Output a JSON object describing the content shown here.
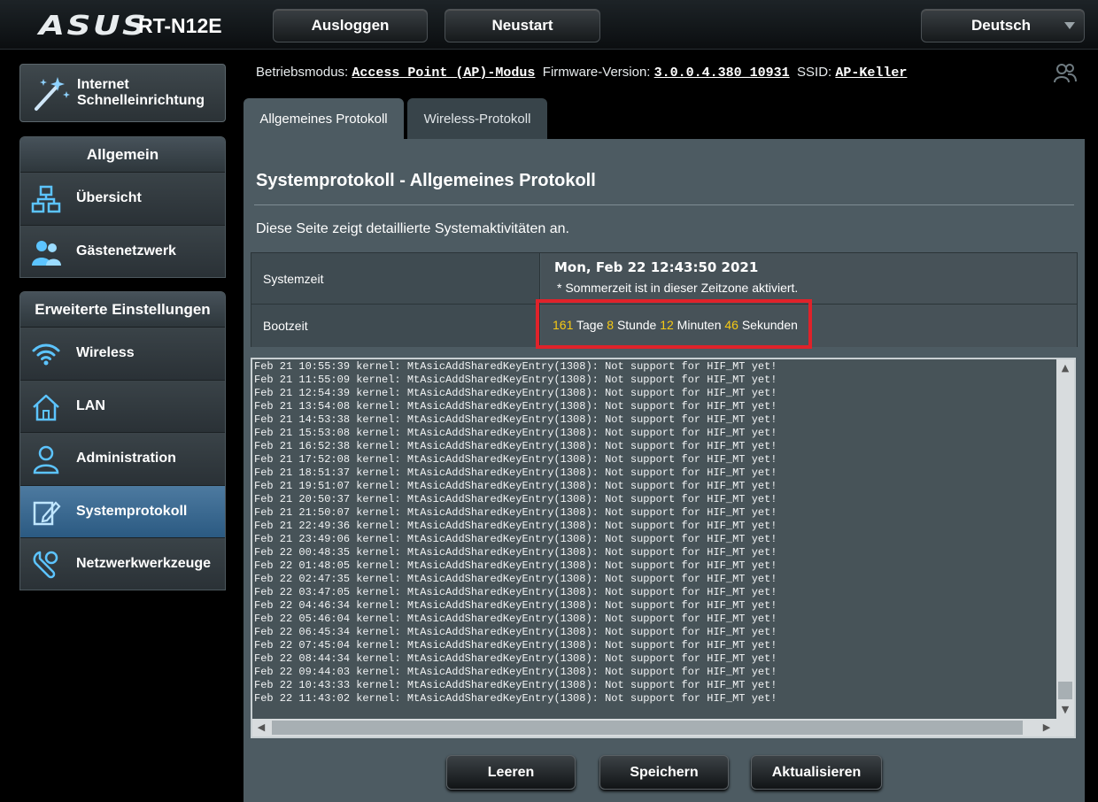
{
  "header": {
    "logo": "ASUS",
    "model": "RT-N12E",
    "logout_label": "Ausloggen",
    "reboot_label": "Neustart",
    "language": "Deutsch"
  },
  "sidebar": {
    "quick_setup": "Internet Schnelleinrichtung",
    "general": {
      "title": "Allgemein",
      "items": [
        {
          "label": "Übersicht",
          "icon": "network-map-icon"
        },
        {
          "label": "Gästenetzwerk",
          "icon": "guest-network-icon"
        }
      ]
    },
    "advanced": {
      "title": "Erweiterte Einstellungen",
      "items": [
        {
          "label": "Wireless",
          "icon": "wifi-icon"
        },
        {
          "label": "LAN",
          "icon": "home-icon"
        },
        {
          "label": "Administration",
          "icon": "admin-user-icon"
        },
        {
          "label": "Systemprotokoll",
          "icon": "system-log-icon",
          "active": true
        },
        {
          "label": "Netzwerkwerkzeuge",
          "icon": "network-tools-icon"
        }
      ]
    }
  },
  "status": {
    "mode_label": "Betriebsmodus:",
    "mode_value": "Access Point (AP)-Modus",
    "firmware_label": "Firmware-Version:",
    "firmware_value": "3.0.0.4.380_10931",
    "ssid_label": "SSID:",
    "ssid_value": "AP-Keller"
  },
  "tabs": [
    {
      "label": "Allgemeines Protokoll",
      "active": true
    },
    {
      "label": "Wireless-Protokoll",
      "active": false
    }
  ],
  "main": {
    "title": "Systemprotokoll - Allgemeines Protokoll",
    "description": "Diese Seite zeigt detaillierte Systemaktivitäten an.",
    "system_time_label": "Systemzeit",
    "system_time_value": "Mon, Feb 22 12:43:50 2021",
    "dst_note": "* Sommerzeit ist in dieser Zeitzone aktiviert.",
    "boot_time_label": "Bootzeit",
    "boot_time": {
      "days": "161",
      "days_unit": "Tage",
      "hours": "8",
      "hours_unit": "Stunde",
      "minutes": "12",
      "minutes_unit": "Minuten",
      "seconds": "46",
      "seconds_unit": "Sekunden"
    }
  },
  "log_lines": [
    "Feb 21 10:55:39 kernel: MtAsicAddSharedKeyEntry(1308): Not support for HIF_MT yet!",
    "Feb 21 11:55:09 kernel: MtAsicAddSharedKeyEntry(1308): Not support for HIF_MT yet!",
    "Feb 21 12:54:39 kernel: MtAsicAddSharedKeyEntry(1308): Not support for HIF_MT yet!",
    "Feb 21 13:54:08 kernel: MtAsicAddSharedKeyEntry(1308): Not support for HIF_MT yet!",
    "Feb 21 14:53:38 kernel: MtAsicAddSharedKeyEntry(1308): Not support for HIF_MT yet!",
    "Feb 21 15:53:08 kernel: MtAsicAddSharedKeyEntry(1308): Not support for HIF_MT yet!",
    "Feb 21 16:52:38 kernel: MtAsicAddSharedKeyEntry(1308): Not support for HIF_MT yet!",
    "Feb 21 17:52:08 kernel: MtAsicAddSharedKeyEntry(1308): Not support for HIF_MT yet!",
    "Feb 21 18:51:37 kernel: MtAsicAddSharedKeyEntry(1308): Not support for HIF_MT yet!",
    "Feb 21 19:51:07 kernel: MtAsicAddSharedKeyEntry(1308): Not support for HIF_MT yet!",
    "Feb 21 20:50:37 kernel: MtAsicAddSharedKeyEntry(1308): Not support for HIF_MT yet!",
    "Feb 21 21:50:07 kernel: MtAsicAddSharedKeyEntry(1308): Not support for HIF_MT yet!",
    "Feb 21 22:49:36 kernel: MtAsicAddSharedKeyEntry(1308): Not support for HIF_MT yet!",
    "Feb 21 23:49:06 kernel: MtAsicAddSharedKeyEntry(1308): Not support for HIF_MT yet!",
    "Feb 22 00:48:35 kernel: MtAsicAddSharedKeyEntry(1308): Not support for HIF_MT yet!",
    "Feb 22 01:48:05 kernel: MtAsicAddSharedKeyEntry(1308): Not support for HIF_MT yet!",
    "Feb 22 02:47:35 kernel: MtAsicAddSharedKeyEntry(1308): Not support for HIF_MT yet!",
    "Feb 22 03:47:05 kernel: MtAsicAddSharedKeyEntry(1308): Not support for HIF_MT yet!",
    "Feb 22 04:46:34 kernel: MtAsicAddSharedKeyEntry(1308): Not support for HIF_MT yet!",
    "Feb 22 05:46:04 kernel: MtAsicAddSharedKeyEntry(1308): Not support for HIF_MT yet!",
    "Feb 22 06:45:34 kernel: MtAsicAddSharedKeyEntry(1308): Not support for HIF_MT yet!",
    "Feb 22 07:45:04 kernel: MtAsicAddSharedKeyEntry(1308): Not support for HIF_MT yet!",
    "Feb 22 08:44:34 kernel: MtAsicAddSharedKeyEntry(1308): Not support for HIF_MT yet!",
    "Feb 22 09:44:03 kernel: MtAsicAddSharedKeyEntry(1308): Not support for HIF_MT yet!",
    "Feb 22 10:43:33 kernel: MtAsicAddSharedKeyEntry(1308): Not support for HIF_MT yet!",
    "Feb 22 11:43:02 kernel: MtAsicAddSharedKeyEntry(1308): Not support for HIF_MT yet!"
  ],
  "buttons": {
    "clear": "Leeren",
    "save": "Speichern",
    "refresh": "Aktualisieren"
  },
  "colors": {
    "boot_number": "#f6c913",
    "highlight_frame": "#e0222a",
    "active_menu": "#3d6d96",
    "panel": "#4d5b62"
  }
}
